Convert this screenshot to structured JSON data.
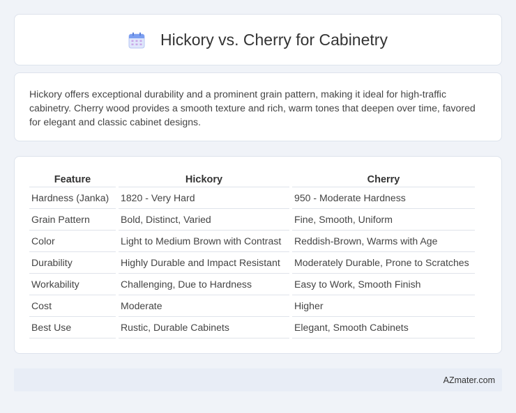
{
  "header": {
    "title": "Hickory vs. Cherry for Cabinetry",
    "icon": "calendar-icon"
  },
  "intro": {
    "text": "Hickory offers exceptional durability and a prominent grain pattern, making it ideal for high-traffic cabinetry. Cherry wood provides a smooth texture and rich, warm tones that deepen over time, favored for elegant and classic cabinet designs."
  },
  "table": {
    "headers": [
      "Feature",
      "Hickory",
      "Cherry"
    ],
    "rows": [
      [
        "Hardness (Janka)",
        "1820 - Very Hard",
        "950 - Moderate Hardness"
      ],
      [
        "Grain Pattern",
        "Bold, Distinct, Varied",
        "Fine, Smooth, Uniform"
      ],
      [
        "Color",
        "Light to Medium Brown with Contrast",
        "Reddish-Brown, Warms with Age"
      ],
      [
        "Durability",
        "Highly Durable and Impact Resistant",
        "Moderately Durable, Prone to Scratches"
      ],
      [
        "Workability",
        "Challenging, Due to Hardness",
        "Easy to Work, Smooth Finish"
      ],
      [
        "Cost",
        "Moderate",
        "Higher"
      ],
      [
        "Best Use",
        "Rustic, Durable Cabinets",
        "Elegant, Smooth Cabinets"
      ]
    ]
  },
  "footer": {
    "brand": "AZmater.com"
  },
  "colors": {
    "background": "#f0f3f8",
    "card": "#ffffff",
    "footer": "#e8edf6",
    "icon_accent": "#7b9ef0"
  }
}
